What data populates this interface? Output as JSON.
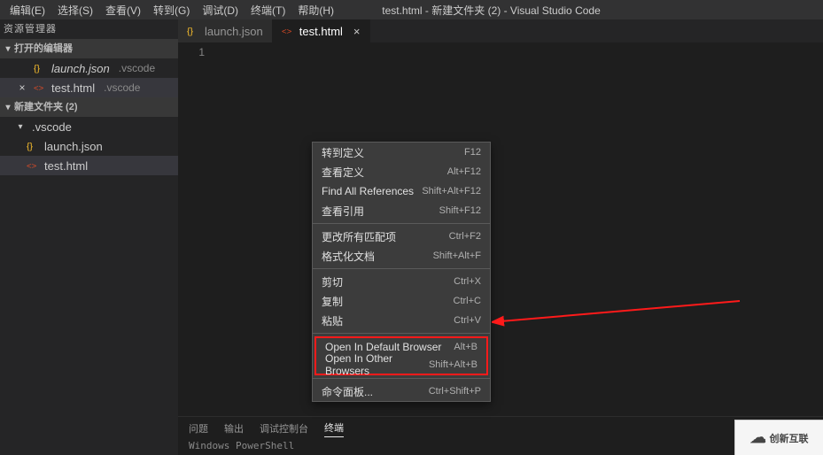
{
  "menubar": {
    "items": [
      "编辑(E)",
      "选择(S)",
      "查看(V)",
      "转到(G)",
      "调试(D)",
      "终端(T)",
      "帮助(H)"
    ],
    "title": "test.html - 新建文件夹 (2) - Visual Studio Code"
  },
  "sidebar": {
    "explorer_title": "资源管理器",
    "open_editors_header": "打开的编辑器",
    "open_editors": [
      {
        "name": "launch.json",
        "path": ".vscode",
        "icon": "json",
        "italic": true
      },
      {
        "name": "test.html",
        "path": ".vscode",
        "icon": "html",
        "italic": false,
        "selected": true
      }
    ],
    "folder_root": "新建文件夹 (2)",
    "tree": [
      {
        "name": ".vscode",
        "type": "folder",
        "expanded": true
      },
      {
        "name": "launch.json",
        "type": "file",
        "icon": "json"
      },
      {
        "name": "test.html",
        "type": "file",
        "icon": "html",
        "selected": true
      }
    ]
  },
  "tabs": [
    {
      "name": "launch.json",
      "icon": "json",
      "active": false
    },
    {
      "name": "test.html",
      "icon": "html",
      "active": true,
      "close": "×"
    }
  ],
  "editor": {
    "line_number": "1"
  },
  "context_menu": {
    "group1": [
      {
        "label": "转到定义",
        "shortcut": "F12"
      },
      {
        "label": "查看定义",
        "shortcut": "Alt+F12"
      },
      {
        "label": "Find All References",
        "shortcut": "Shift+Alt+F12"
      },
      {
        "label": "查看引用",
        "shortcut": "Shift+F12"
      }
    ],
    "group2": [
      {
        "label": "更改所有匹配项",
        "shortcut": "Ctrl+F2"
      },
      {
        "label": "格式化文档",
        "shortcut": "Shift+Alt+F"
      }
    ],
    "group3": [
      {
        "label": "剪切",
        "shortcut": "Ctrl+X"
      },
      {
        "label": "复制",
        "shortcut": "Ctrl+C"
      },
      {
        "label": "粘贴",
        "shortcut": "Ctrl+V"
      }
    ],
    "highlighted": [
      {
        "label": "Open In Default Browser",
        "shortcut": "Alt+B"
      },
      {
        "label": "Open In Other Browsers",
        "shortcut": "Shift+Alt+B"
      }
    ],
    "group5": [
      {
        "label": "命令面板...",
        "shortcut": "Ctrl+Shift+P"
      }
    ]
  },
  "panel": {
    "tabs": [
      "问题",
      "输出",
      "调试控制台",
      "终端"
    ],
    "active_index": 3,
    "line": "Windows PowerShell"
  },
  "watermark": "创新互联",
  "icons": {
    "json_color": "#fbc02d",
    "html_color": "#e44d26"
  }
}
